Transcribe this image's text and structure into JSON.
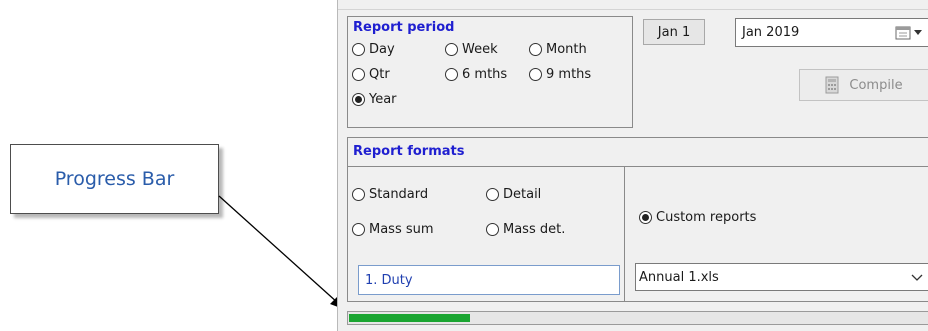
{
  "callout": {
    "label": "Progress Bar"
  },
  "report_period": {
    "title": "Report period",
    "options": [
      {
        "label": "Day",
        "selected": false
      },
      {
        "label": "Week",
        "selected": false
      },
      {
        "label": "Month",
        "selected": false
      },
      {
        "label": "Qtr",
        "selected": false
      },
      {
        "label": "6 mths",
        "selected": false
      },
      {
        "label": "9 mths",
        "selected": false
      },
      {
        "label": "Year",
        "selected": true
      }
    ]
  },
  "date": {
    "start_label": "Jan 1",
    "value": "Jan 2019"
  },
  "compile_button": {
    "label": "Compile",
    "enabled": false
  },
  "report_formats": {
    "title": "Report formats",
    "options": [
      {
        "label": "Standard",
        "selected": false
      },
      {
        "label": "Detail",
        "selected": false
      },
      {
        "label": "Mass sum",
        "selected": false
      },
      {
        "label": "Mass det.",
        "selected": false
      }
    ],
    "custom": {
      "label": "Custom reports",
      "selected": true
    },
    "duty_field": "1. Duty",
    "file_select": "Annual 1.xls"
  },
  "progress": {
    "fraction": 0.21,
    "color": "#1aa531"
  }
}
